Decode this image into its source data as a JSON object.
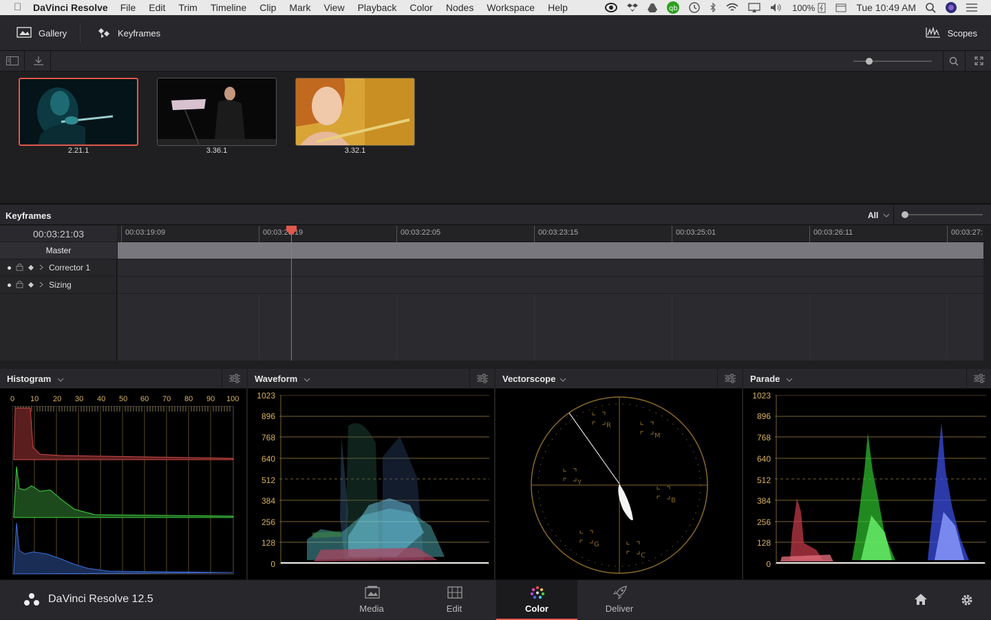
{
  "menubar": {
    "app_name": "DaVinci Resolve",
    "items": [
      "File",
      "Edit",
      "Trim",
      "Timeline",
      "Clip",
      "Mark",
      "View",
      "Playback",
      "Color",
      "Nodes",
      "Workspace",
      "Help"
    ],
    "battery": "100%",
    "clock": "Tue 10:49 AM"
  },
  "toolbar": {
    "gallery_label": "Gallery",
    "keyframes_label": "Keyframes",
    "scopes_label": "Scopes"
  },
  "gallery": {
    "stills": [
      {
        "label": "2.21.1",
        "selected": true
      },
      {
        "label": "3.36.1",
        "selected": false
      },
      {
        "label": "3.32.1",
        "selected": false
      }
    ]
  },
  "keyframes": {
    "title": "Keyframes",
    "filter": "All",
    "timecode": "00:03:21:03",
    "ruler": [
      "00:03:19:09",
      "00:03:20:19",
      "00:03:22:05",
      "00:03:23:15",
      "00:03:25:01",
      "00:03:26:11",
      "00:03:27:"
    ],
    "master_label": "Master",
    "tracks": [
      {
        "label": "Corrector 1"
      },
      {
        "label": "Sizing"
      }
    ]
  },
  "scopes": {
    "histogram": {
      "title": "Histogram",
      "x_labels": [
        "0",
        "10",
        "20",
        "30",
        "40",
        "50",
        "60",
        "70",
        "80",
        "90",
        "100"
      ]
    },
    "waveform": {
      "title": "Waveform",
      "y_labels": [
        "1023",
        "896",
        "768",
        "640",
        "512",
        "384",
        "256",
        "128",
        "0"
      ]
    },
    "vectorscope": {
      "title": "Vectorscope",
      "targets": [
        "R",
        "M",
        "Y",
        "B",
        "G",
        "C"
      ]
    },
    "parade": {
      "title": "Parade",
      "y_labels": [
        "1023",
        "896",
        "768",
        "640",
        "512",
        "384",
        "256",
        "128",
        "0"
      ]
    }
  },
  "bottom": {
    "app_version": "DaVinci Resolve 12.5",
    "pages": [
      {
        "label": "Media",
        "icon": "media-icon"
      },
      {
        "label": "Edit",
        "icon": "edit-icon"
      },
      {
        "label": "Color",
        "icon": "color-icon",
        "active": true
      },
      {
        "label": "Deliver",
        "icon": "deliver-icon"
      }
    ]
  },
  "colors": {
    "accent": "#e2584b",
    "scope_gold": "#d9b25c"
  }
}
